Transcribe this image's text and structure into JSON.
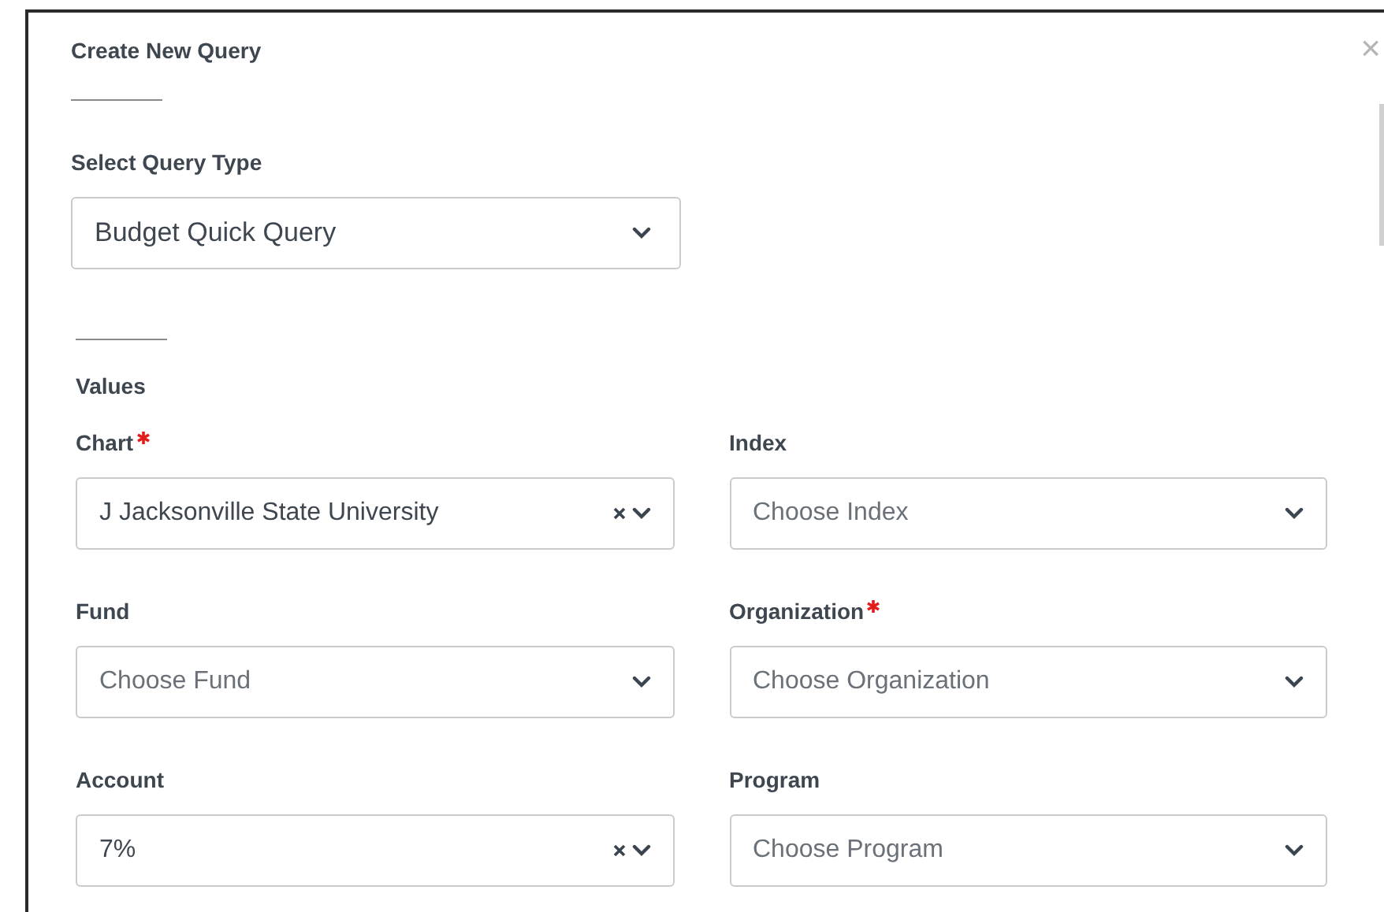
{
  "dialog": {
    "title": "Create New Query",
    "close": "×"
  },
  "query_type": {
    "label": "Select Query Type",
    "value": "Budget Quick Query"
  },
  "values_section": {
    "heading": "Values"
  },
  "fields": [
    {
      "label": "Chart",
      "required": true,
      "value": "J Jacksonville State University",
      "clearable": true
    },
    {
      "label": "Index",
      "required": false,
      "placeholder": "Choose Index",
      "clearable": false
    },
    {
      "label": "Fund",
      "required": false,
      "placeholder": "Choose Fund",
      "clearable": false
    },
    {
      "label": "Organization",
      "required": true,
      "placeholder": "Choose Organization",
      "clearable": false
    },
    {
      "label": "Account",
      "required": false,
      "value": "7%",
      "clearable": true
    },
    {
      "label": "Program",
      "required": false,
      "placeholder": "Choose Program",
      "clearable": false
    }
  ]
}
